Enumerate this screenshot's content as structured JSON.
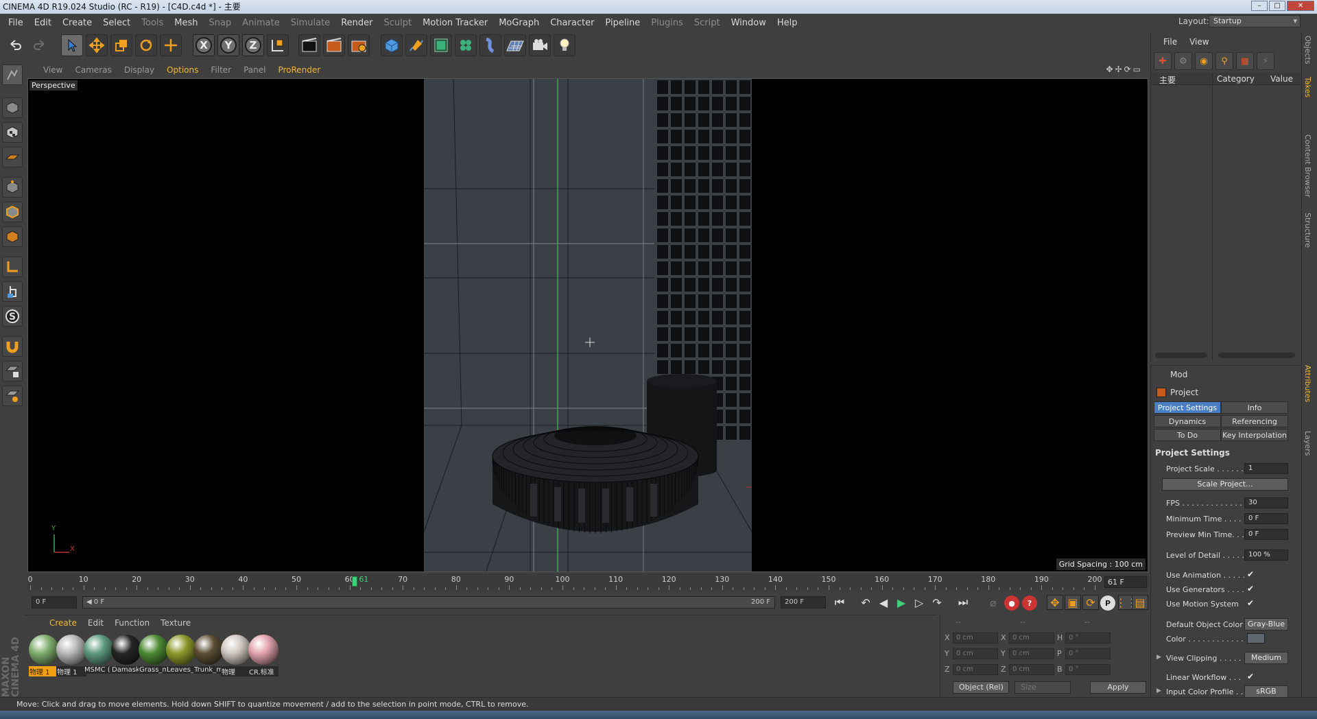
{
  "window": {
    "title": "CINEMA 4D R19.024 Studio (RC - R19) - [C4D.c4d *] - 主要"
  },
  "menu": [
    "File",
    "Edit",
    "Create",
    "Select",
    "Tools",
    "Mesh",
    "Snap",
    "Animate",
    "Simulate",
    "Render",
    "Sculpt",
    "Motion Tracker",
    "MoGraph",
    "Character",
    "Pipeline",
    "Plugins",
    "Script",
    "Window",
    "Help"
  ],
  "menu_dim": [
    "Tools",
    "Snap",
    "Animate",
    "Simulate",
    "Sculpt",
    "Plugins",
    "Script"
  ],
  "layout": {
    "label": "Layout:",
    "value": "Startup"
  },
  "toolbar_icons": [
    "undo-icon",
    "redo-icon",
    "select-icon",
    "move-icon",
    "scale-icon",
    "rotate-icon",
    "transform-icon",
    "x-axis-icon",
    "y-axis-icon",
    "z-axis-icon",
    "coordinate-system-icon",
    "render-view-icon",
    "render-picture-viewer-icon",
    "render-settings-icon",
    "cube-icon",
    "pen-icon",
    "subdivision-icon",
    "cloner-icon",
    "deformer-icon",
    "floor-icon",
    "camera-icon",
    "light-icon"
  ],
  "axis_labels": [
    "X",
    "Y",
    "Z"
  ],
  "viewport": {
    "menu": [
      "View",
      "Cameras",
      "Display",
      "Options",
      "Filter",
      "Panel",
      "ProRender"
    ],
    "active_menu": [
      "Options",
      "ProRender"
    ],
    "label": "Perspective",
    "grid_spacing": "Grid Spacing : 100 cm",
    "axis": {
      "x": "X",
      "y": "Y"
    }
  },
  "timeline": {
    "ticks": [
      "0",
      "10",
      "20",
      "30",
      "40",
      "50",
      "60",
      "70",
      "80",
      "90",
      "100",
      "110",
      "120",
      "130",
      "140",
      "150",
      "160",
      "170",
      "180",
      "190",
      "200"
    ],
    "current_frame_label": "61",
    "current_frame": 61,
    "max_frame": 200,
    "frame_field": "61 F"
  },
  "transport": {
    "start": "0 F",
    "slider_start": "◀ 0 F",
    "slider_end": "200 F",
    "end": "200 F"
  },
  "materials": {
    "menu": [
      "Create",
      "Edit",
      "Function",
      "Texture"
    ],
    "active_menu": "Create",
    "items": [
      {
        "label": "物理 1",
        "color": "#7fae6e",
        "selected": true
      },
      {
        "label": "物理 1",
        "color": "#b9b9b9",
        "selected": false
      },
      {
        "label": "MSMC (",
        "color": "#5e9a80",
        "selected": false
      },
      {
        "label": "Damask",
        "color": "#262626",
        "selected": false
      },
      {
        "label": "Grass_m",
        "color": "#4e8a35",
        "selected": false
      },
      {
        "label": "Leaves_",
        "color": "#8d9a2c",
        "selected": false
      },
      {
        "label": "Trunk_m",
        "color": "#5b4d34",
        "selected": false
      },
      {
        "label": "物理",
        "color": "#cfc6bf",
        "selected": false
      },
      {
        "label": "CR.标准",
        "color": "#e2a3ad",
        "selected": false
      }
    ]
  },
  "brand": {
    "logo": "MAXON CINEMA 4D"
  },
  "coordinates": {
    "headers": [
      "--",
      "--",
      "--"
    ],
    "rows": [
      {
        "a": "X",
        "av": "0 cm",
        "b": "X",
        "bv": "0 cm",
        "c": "H",
        "cv": "0 °"
      },
      {
        "a": "Y",
        "av": "0 cm",
        "b": "Y",
        "bv": "0 cm",
        "c": "P",
        "cv": "0 °"
      },
      {
        "a": "Z",
        "av": "0 cm",
        "b": "Z",
        "bv": "0 cm",
        "c": "B",
        "cv": "0 °"
      }
    ],
    "mode": "Object (Rel)",
    "size": "Size",
    "apply": "Apply"
  },
  "objects": {
    "menu": [
      "File",
      "View"
    ],
    "columns": {
      "object": "主要",
      "category": "Category",
      "value": "Value"
    }
  },
  "side_tabs": [
    "Objects",
    "Takes",
    "Content Browser",
    "Structure",
    "Attributes",
    "Layers"
  ],
  "attributes": {
    "menu": "Mod",
    "title": "Project",
    "tabs": [
      {
        "label": "Project Settings",
        "selected": true
      },
      {
        "label": "Info",
        "selected": false
      },
      {
        "label": "Dynamics",
        "selected": false
      },
      {
        "label": "Referencing",
        "selected": false
      },
      {
        "label": "To Do",
        "selected": false
      },
      {
        "label": "Key Interpolation",
        "selected": false
      }
    ],
    "section": "Project Settings",
    "project_scale": {
      "label": "Project Scale . . . . . .",
      "value": "1"
    },
    "scale_project": "Scale Project...",
    "fps": {
      "label": "FPS . . . . . . . . . . . . . .",
      "value": "30"
    },
    "min_time": {
      "label": "Minimum Time . . . . .",
      "value": "0 F"
    },
    "preview_min": {
      "label": "Preview Min Time. . .",
      "value": "0 F"
    },
    "lod": {
      "label": "Level of Detail . . . . .",
      "value": "100 %"
    },
    "use_animation": {
      "label": "Use Animation . . . . .",
      "value": "✔"
    },
    "use_generators": {
      "label": "Use Generators . . . .",
      "value": "✔"
    },
    "use_motion": {
      "label": "Use Motion System",
      "value": "✔"
    },
    "default_color": {
      "label": "Default Object Color",
      "value": "Gray-Blue"
    },
    "color": {
      "label": "Color . . . . . . . . . . . ."
    },
    "view_clipping": {
      "label": "View Clipping . . . . .",
      "value": "Medium"
    },
    "linear_workflow": {
      "label": "Linear Workflow . . .",
      "value": "✔"
    },
    "input_profile": {
      "label": "Input Color Profile . .",
      "value": "sRGB"
    }
  },
  "status": "Move: Click and drag to move elements. Hold down SHIFT to quantize movement / add to the selection in point mode, CTRL to remove."
}
